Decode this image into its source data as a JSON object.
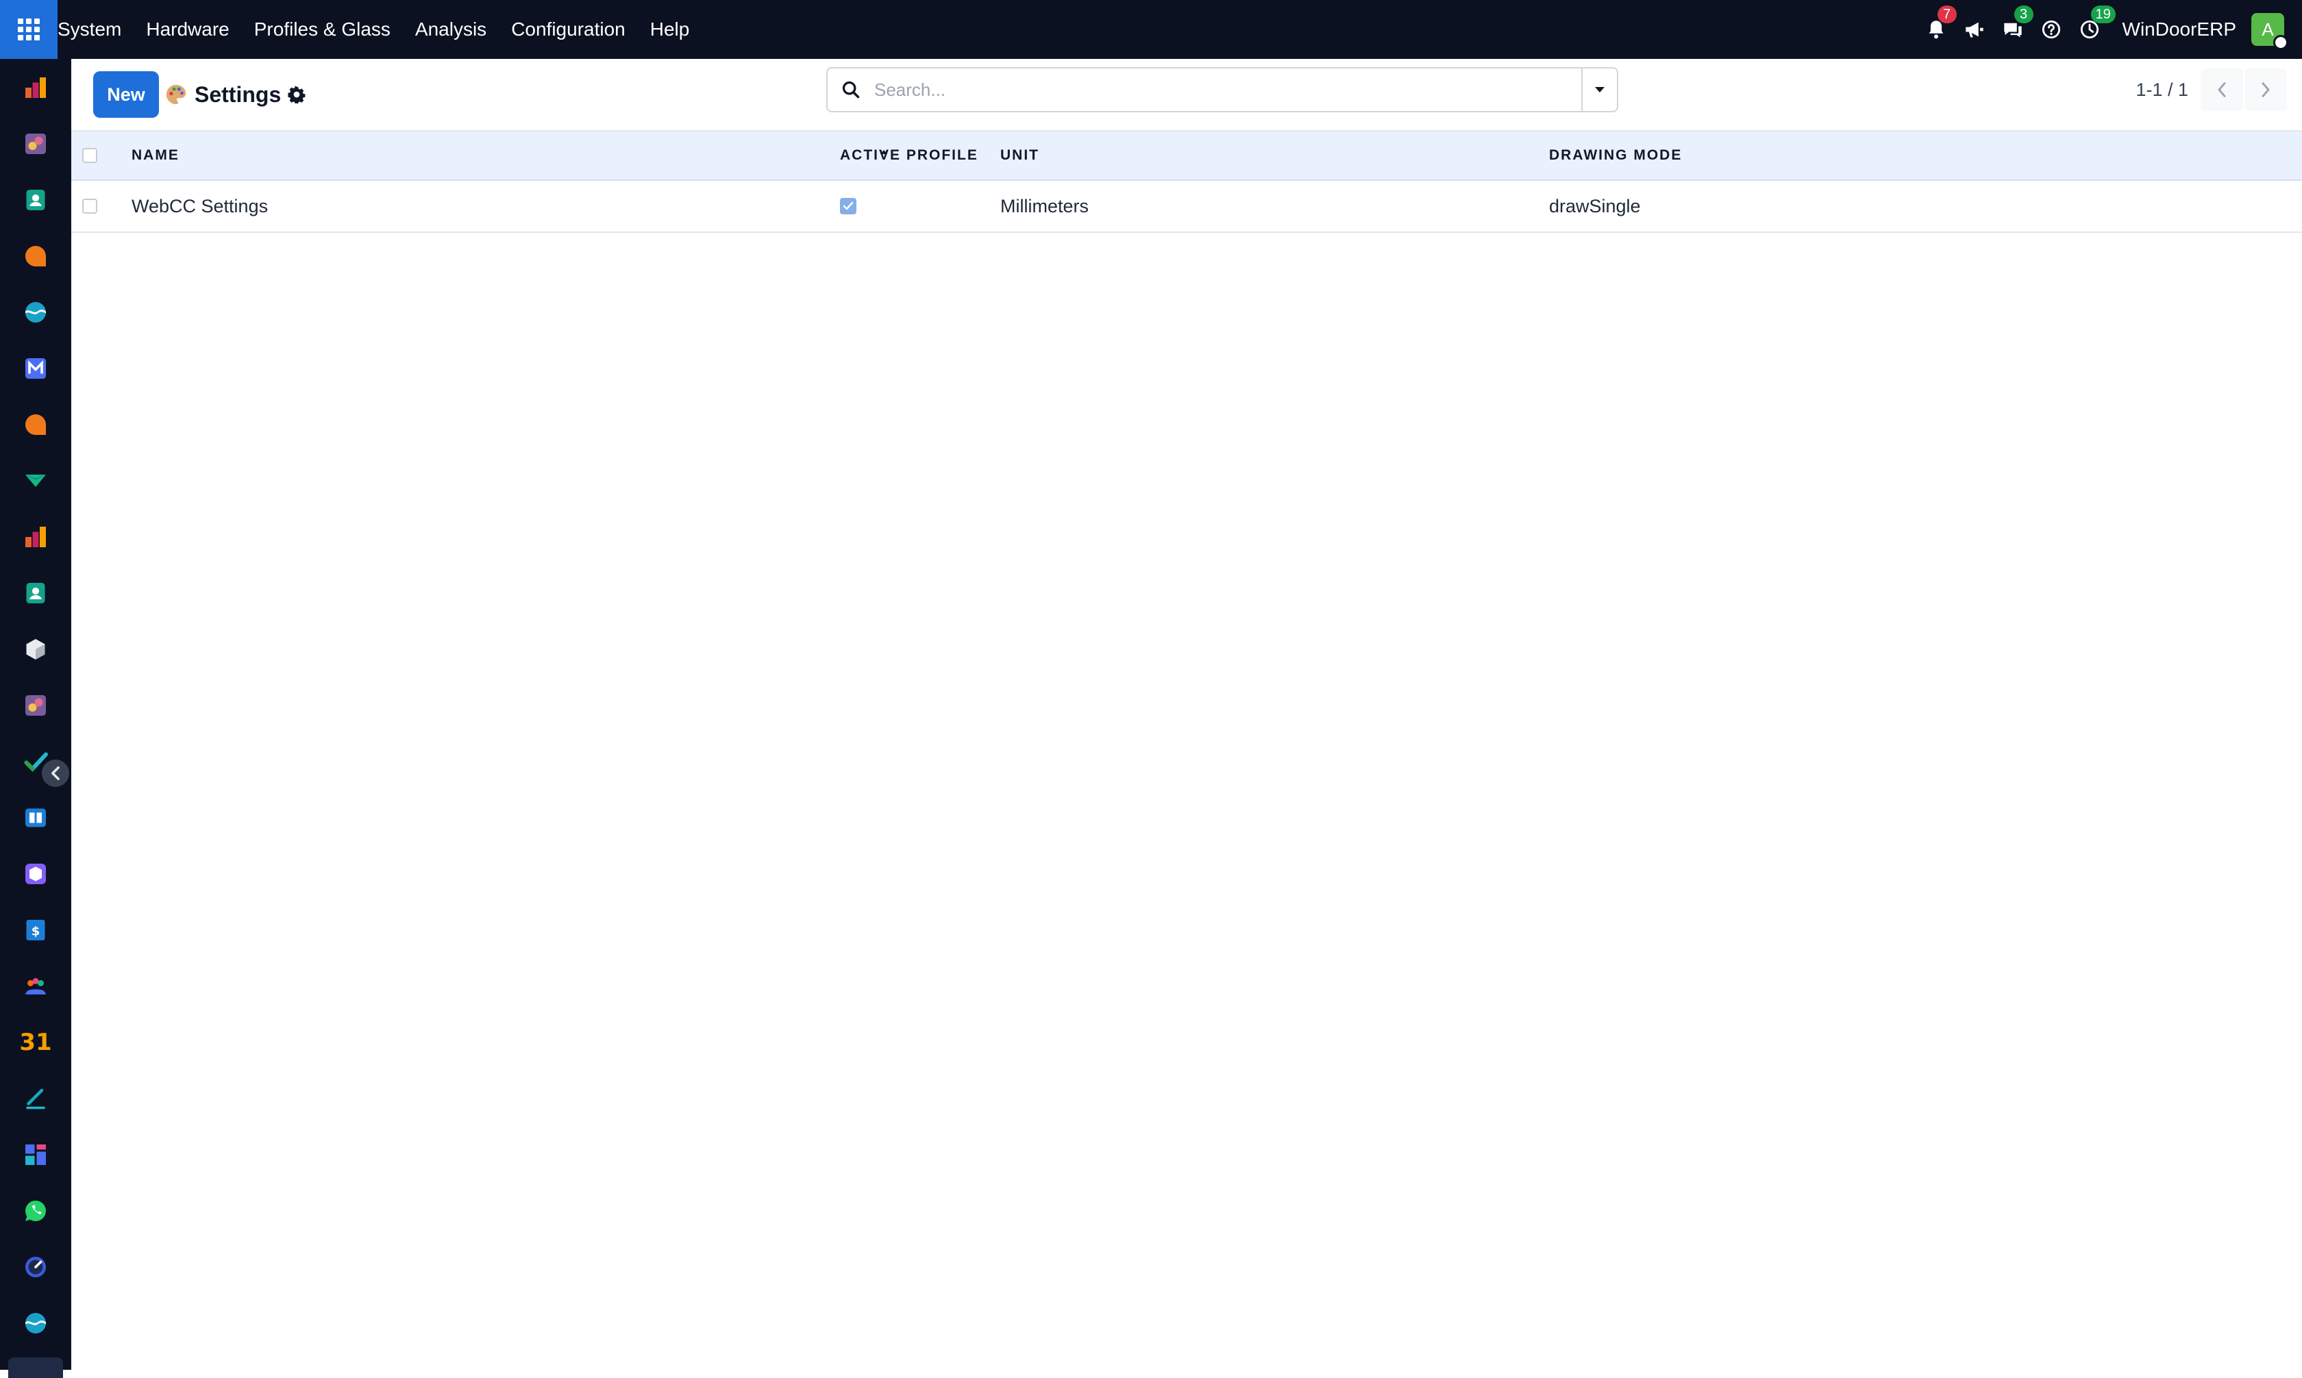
{
  "topbar": {
    "menu": [
      "System",
      "Hardware",
      "Profiles & Glass",
      "Analysis",
      "Configuration",
      "Help"
    ],
    "notifications": {
      "icon": "bell-icon",
      "count": "7"
    },
    "announcements": {
      "icon": "megaphone-icon"
    },
    "messages": {
      "icon": "chat-icon",
      "count": "3"
    },
    "help": {
      "icon": "help-icon"
    },
    "activities": {
      "icon": "clock-icon",
      "count": "19"
    },
    "company": "WinDoorERP",
    "avatar_initial": "A"
  },
  "sidebar": {
    "apps": [
      "bar-chart-app-icon",
      "colors-app-icon",
      "contacts-app-icon",
      "chat-bubble-app-icon",
      "wave-app-icon",
      "mail-app-icon",
      "chat-bubble-app-icon",
      "fold-app-icon",
      "bar-chart-app-icon",
      "contacts-app-icon",
      "cube-app-icon",
      "colors-app-icon",
      "check-app-icon",
      "book-app-icon",
      "box-app-icon",
      "dollar-app-icon",
      "team-app-icon",
      "calendar-app-icon",
      "sign-app-icon",
      "dashboard-app-icon",
      "whatsapp-app-icon",
      "gauge-app-icon",
      "wave-app-icon"
    ],
    "calendar_day": "31"
  },
  "control": {
    "new_label": "New",
    "title": "Settings",
    "search_placeholder": "Search...",
    "pager": "1-1 / 1"
  },
  "table": {
    "columns": [
      "Name",
      "Active Profile",
      "Unit",
      "Drawing Mode"
    ],
    "rows": [
      {
        "name": "WebCC Settings",
        "active_profile": true,
        "unit": "Millimeters",
        "drawing_mode": "drawSingle"
      }
    ]
  },
  "colors": {
    "navbar": "#0b1120",
    "primary": "#1e6fd9",
    "header_bg": "#e8f1fd",
    "badge_red": "#dc3545",
    "badge_green": "#16a34a",
    "avatar": "#57b947"
  }
}
